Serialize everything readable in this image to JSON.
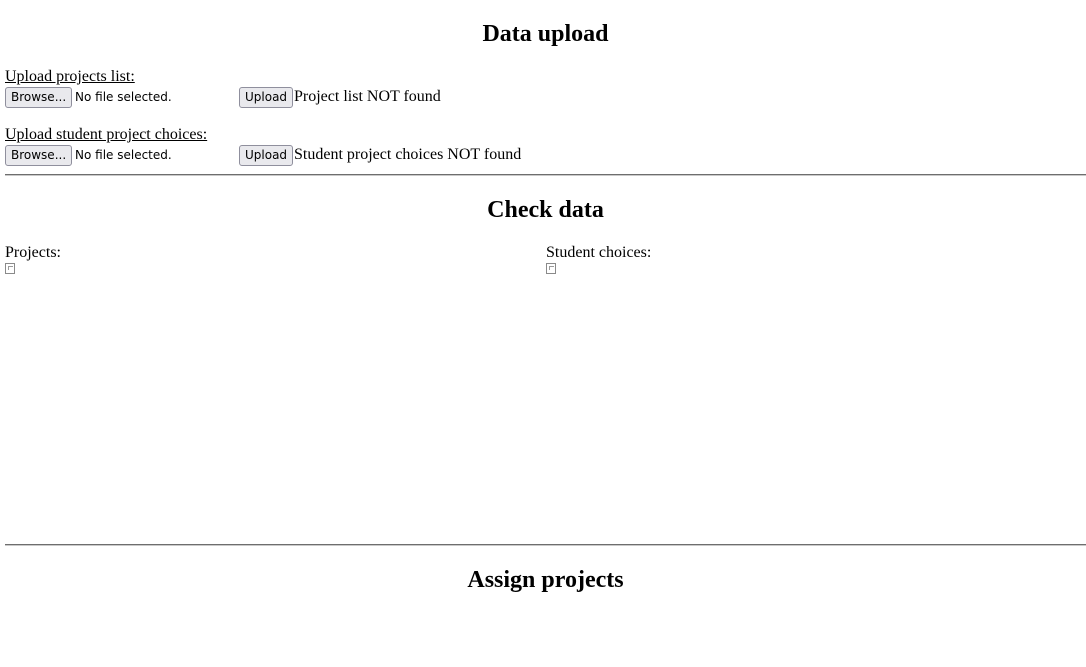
{
  "upload_section": {
    "title": "Data upload",
    "projects": {
      "label": "Upload projects list:",
      "browse_label": "Browse...",
      "file_status": "No file selected.",
      "upload_label": "Upload",
      "result": "Project list NOT found"
    },
    "choices": {
      "label": "Upload student project choices:",
      "browse_label": "Browse...",
      "file_status": "No file selected.",
      "upload_label": "Upload",
      "result": "Student project choices NOT found"
    }
  },
  "check_section": {
    "title": "Check data",
    "projects_label": "Projects:",
    "choices_label": "Student choices:"
  },
  "assign_section": {
    "title": "Assign projects"
  }
}
